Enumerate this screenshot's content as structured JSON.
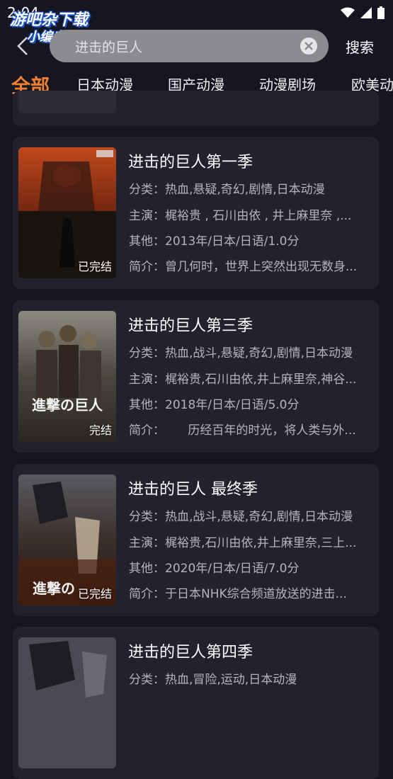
{
  "status_bar": {
    "time": "2:04"
  },
  "watermark": {
    "line1": "游吧杂下载",
    "line2": "小编亲测"
  },
  "search": {
    "value": "进击的巨人",
    "button_label": "搜索"
  },
  "tabs": [
    {
      "label": "全部",
      "active": true
    },
    {
      "label": "日本动漫",
      "active": false
    },
    {
      "label": "国产动漫",
      "active": false
    },
    {
      "label": "动漫剧场",
      "active": false
    },
    {
      "label": "欧美动",
      "active": false
    }
  ],
  "labels": {
    "category": "分类：",
    "cast": "主演：",
    "other": "其他：",
    "intro": "简介："
  },
  "results": [
    {
      "title": "进击的巨人第一季",
      "status": "已完结",
      "category": "热血,悬疑,奇幻,剧情,日本动漫",
      "cast": "梶裕贵 , 石川由依 , 井上麻里奈 ,...",
      "other": "2013年/日本/日语/1.0分",
      "intro": "曾几何时，世界上突然出现无数身..."
    },
    {
      "title": "进击的巨人第三季",
      "status": "完结",
      "category": "热血,战斗,悬疑,奇幻,剧情,日本动漫",
      "cast": "梶裕贵,石川由依,井上麻里奈,神谷...",
      "other": "2018年/日本/日语/5.0分",
      "intro": "      历经百年的时光，将人类与外..."
    },
    {
      "title": "进击的巨人 最终季",
      "status": "已完结",
      "category": "热血,战斗,悬疑,奇幻,剧情,日本动漫",
      "cast": "梶裕贵,石川由依,井上麻里奈,三上...",
      "other": "2020年/日本/日语/7.0分",
      "intro": "于日本NHK综合频道放送的进击..."
    },
    {
      "title": "进击的巨人第四季",
      "status": "",
      "category": "热血,冒险,运动,日本动漫",
      "cast": "",
      "other": "",
      "intro": ""
    }
  ]
}
